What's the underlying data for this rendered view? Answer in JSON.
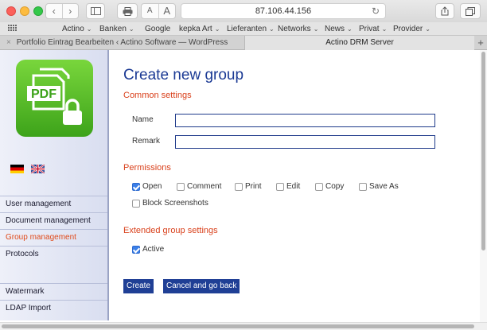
{
  "browser": {
    "url": "87.106.44.156",
    "text_size_small": "A",
    "text_size_large": "A"
  },
  "favorites": [
    {
      "label": "Actino",
      "dropdown": true
    },
    {
      "label": "Banken",
      "dropdown": true
    },
    {
      "label": "Google",
      "dropdown": false
    },
    {
      "label": "kepka Art",
      "dropdown": true
    },
    {
      "label": "Lieferanten",
      "dropdown": true
    },
    {
      "label": "Networks",
      "dropdown": true
    },
    {
      "label": "News",
      "dropdown": true
    },
    {
      "label": "Privat",
      "dropdown": true
    },
    {
      "label": "Provider",
      "dropdown": true
    }
  ],
  "tabs": [
    {
      "label": "Portfolio Eintrag Bearbeiten ‹ Actino Software — WordPress",
      "active": false
    },
    {
      "label": "Actino DRM Server",
      "active": true
    }
  ],
  "sidebar": {
    "logo_text": "PDF",
    "nav": [
      {
        "label": "User management",
        "active": false
      },
      {
        "label": "Document management",
        "active": false
      },
      {
        "label": "Group management",
        "active": true
      },
      {
        "label": "Protocols",
        "active": false
      },
      {
        "label": "Watermark",
        "active": false
      },
      {
        "label": "LDAP Import",
        "active": false
      }
    ]
  },
  "form": {
    "title": "Create new group",
    "common_heading": "Common settings",
    "name_label": "Name",
    "name_value": "",
    "remark_label": "Remark",
    "remark_value": "",
    "permissions_heading": "Permissions",
    "permissions": [
      {
        "label": "Open",
        "checked": true
      },
      {
        "label": "Comment",
        "checked": false
      },
      {
        "label": "Print",
        "checked": false
      },
      {
        "label": "Edit",
        "checked": false
      },
      {
        "label": "Copy",
        "checked": false
      },
      {
        "label": "Save As",
        "checked": false
      },
      {
        "label": "Block Screenshots",
        "checked": false
      }
    ],
    "extended_heading": "Extended group settings",
    "active_label": "Active",
    "active_checked": true,
    "create_label": "Create",
    "cancel_label": "Cancel and go back"
  },
  "colors": {
    "title_blue": "#1b3a94",
    "heading_red": "#d9401b",
    "button_blue": "#1f3f95",
    "active_nav": "#e04a1a"
  }
}
